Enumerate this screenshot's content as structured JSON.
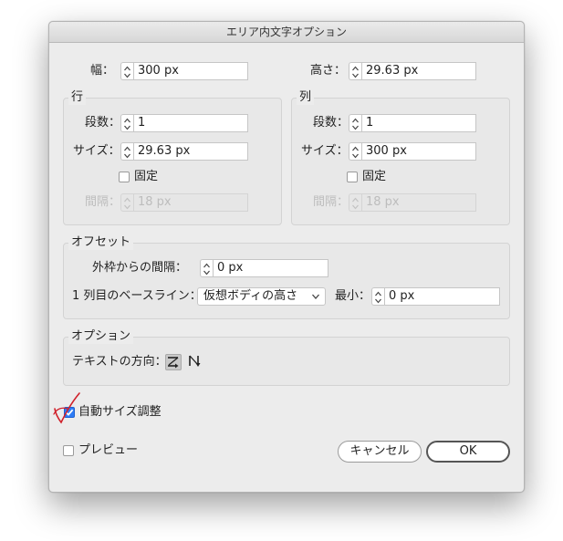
{
  "dialog": {
    "title": "エリア内文字オプション"
  },
  "size": {
    "width_label": "幅：",
    "width_value": "300 px",
    "height_label": "高さ：",
    "height_value": "29.63 px"
  },
  "rows": {
    "title": "行",
    "count_label": "段数：",
    "count_value": "1",
    "size_label": "サイズ：",
    "size_value": "29.63 px",
    "fixed_label": "固定",
    "fixed_checked": false,
    "gutter_label": "間隔：",
    "gutter_value": "18 px"
  },
  "columns": {
    "title": "列",
    "count_label": "段数：",
    "count_value": "1",
    "size_label": "サイズ：",
    "size_value": "300 px",
    "fixed_label": "固定",
    "fixed_checked": false,
    "gutter_label": "間隔：",
    "gutter_value": "18 px"
  },
  "offset": {
    "title": "オフセット",
    "inset_label": "外枠からの間隔：",
    "inset_value": "0 px",
    "baseline_label": "1 列目のベースライン：",
    "baseline_value": "仮想ボディの高さ",
    "min_label": "最小：",
    "min_value": "0 px"
  },
  "options": {
    "title": "オプション",
    "direction_label": "テキストの方向：",
    "direction_icons": [
      "text-flow-rows-icon",
      "text-flow-columns-icon"
    ],
    "selected_direction": "text-flow-rows-icon"
  },
  "auto_size": {
    "label": "自動サイズ調整",
    "checked": true
  },
  "preview": {
    "label": "プレビュー",
    "checked": false
  },
  "buttons": {
    "cancel": "キャンセル",
    "ok": "OK"
  },
  "annotation": {
    "color": "#d0202a",
    "icon": "red-check-mark-icon"
  },
  "colors": {
    "accent": "#2e7cf6"
  }
}
